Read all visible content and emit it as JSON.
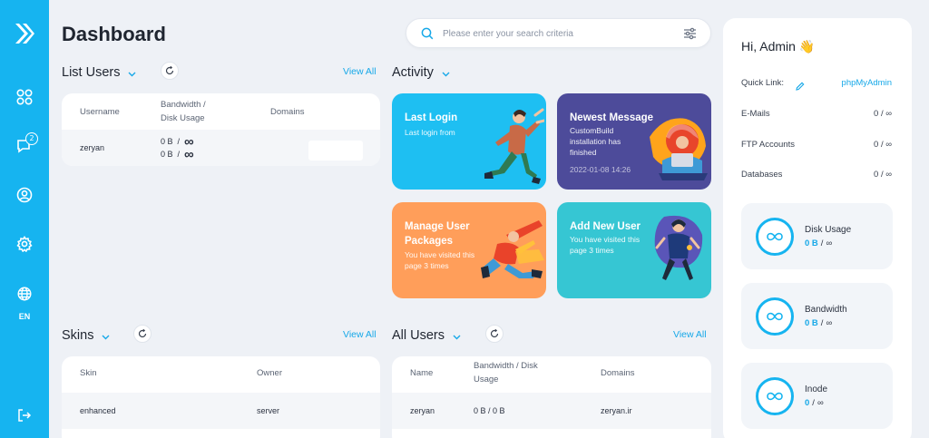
{
  "sidebar": {
    "notifications_badge": "2",
    "language": "EN"
  },
  "header": {
    "title": "Dashboard",
    "search_placeholder": "Please enter your search criteria"
  },
  "list_users": {
    "title": "List Users",
    "view_all": "View All",
    "columns": [
      "Username",
      "Bandwidth /\nDisk Usage",
      "Domains"
    ],
    "rows": [
      {
        "username": "zeryan",
        "bandwidth": "0 B",
        "bandwidth_limit": "∞",
        "disk": "0 B",
        "disk_limit": "∞"
      }
    ]
  },
  "activity": {
    "title": "Activity",
    "tiles": [
      {
        "title": "Last Login",
        "subtitle": "Last login from",
        "color": "#1ebff2"
      },
      {
        "title": "Newest Message",
        "subtitle": "CustomBuild installation has finished",
        "date": "2022-01-08 14:26",
        "color": "#4d4b9a"
      },
      {
        "title": "Manage User Packages",
        "subtitle": "You have visited this page 3 times",
        "color": "#ff9e5a"
      },
      {
        "title": "Add New User",
        "subtitle": "You have visited this page 3 times",
        "color": "#36c6d3"
      }
    ]
  },
  "skins": {
    "title": "Skins",
    "view_all": "View All",
    "columns": [
      "Skin",
      "Owner"
    ],
    "rows": [
      {
        "skin": "enhanced",
        "owner": "server"
      }
    ]
  },
  "all_users": {
    "title": "All Users",
    "view_all": "View All",
    "columns": [
      "Name",
      "Bandwidth / Disk\nUsage",
      "Domains"
    ],
    "rows": [
      {
        "name": "zeryan",
        "usage": "0 B / 0 B",
        "domain": "zeryan.ir"
      }
    ]
  },
  "panel": {
    "greeting": "Hi, Admin 👋",
    "quick_link_label": "Quick Link:",
    "quick_link": "phpMyAdmin",
    "stats": [
      {
        "label": "E-Mails",
        "value": "0 / ∞"
      },
      {
        "label": "FTP Accounts",
        "value": "0 / ∞"
      },
      {
        "label": "Databases",
        "value": "0 / ∞"
      }
    ],
    "usage": [
      {
        "label": "Disk Usage",
        "used": "0 B",
        "max": "∞"
      },
      {
        "label": "Bandwidth",
        "used": "0 B",
        "max": "∞"
      },
      {
        "label": "Inode",
        "used": "0",
        "max": "∞"
      }
    ]
  },
  "colors": {
    "accent": "#16b4f0",
    "background": "#eef1f6"
  }
}
